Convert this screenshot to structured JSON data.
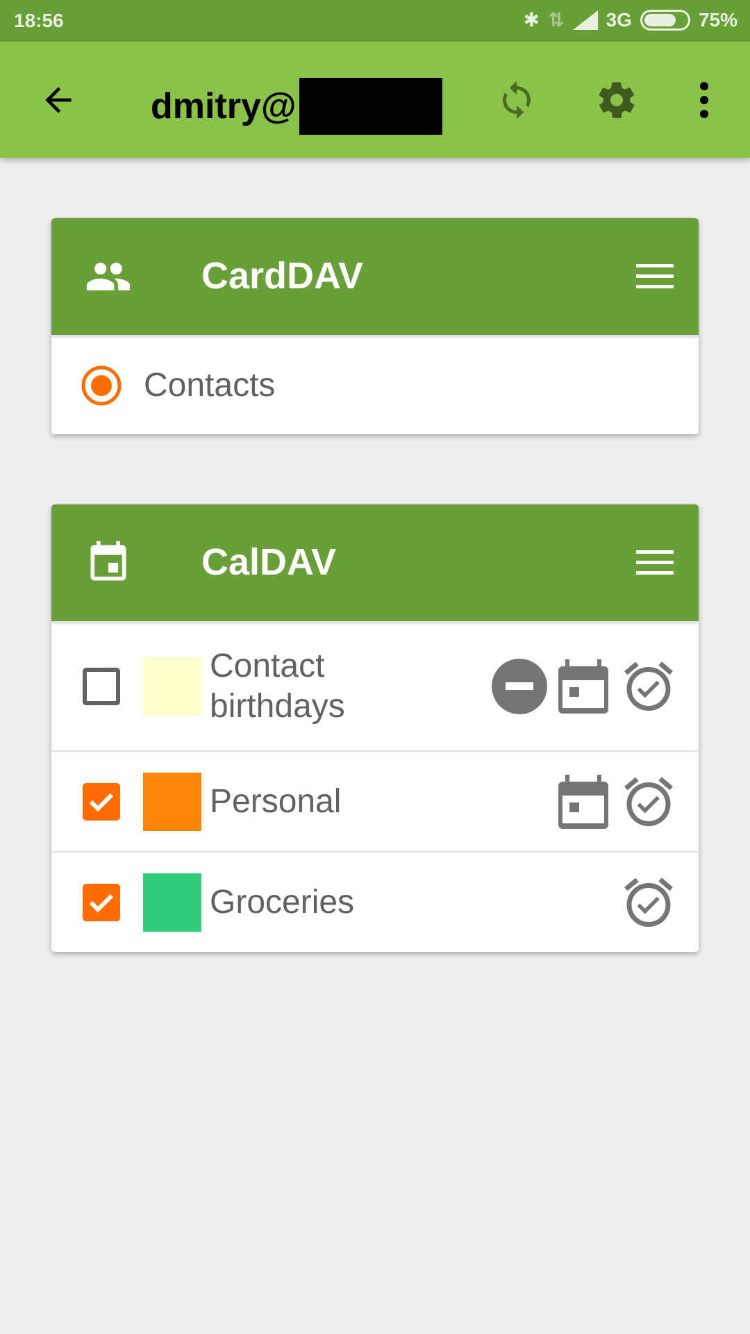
{
  "status_bar": {
    "time": "18:56",
    "network": "3G",
    "battery": "75%",
    "battery_level": 75
  },
  "toolbar": {
    "title": "dmitry@",
    "icons": [
      "back-arrow-icon",
      "sync-icon",
      "gear-icon",
      "more-vert-icon"
    ]
  },
  "carddav": {
    "title": "CardDAV",
    "icon": "people-icon",
    "items": [
      {
        "label": "Contacts",
        "selected": true
      }
    ]
  },
  "caldav": {
    "title": "CalDAV",
    "icon": "calendar-icon",
    "items": [
      {
        "label": "Contact birthdays",
        "checked": false,
        "color": "#ffffcc",
        "read_only": true,
        "events": true,
        "tasks": true
      },
      {
        "label": "Personal",
        "checked": true,
        "color": "#ff8307",
        "read_only": false,
        "events": true,
        "tasks": true
      },
      {
        "label": "Groceries",
        "checked": true,
        "color": "#32cd7c",
        "read_only": false,
        "events": false,
        "tasks": true
      }
    ]
  },
  "colors": {
    "primary": "#8bc34a",
    "primary_dark": "#689f38",
    "accent": "#ff6d00"
  }
}
